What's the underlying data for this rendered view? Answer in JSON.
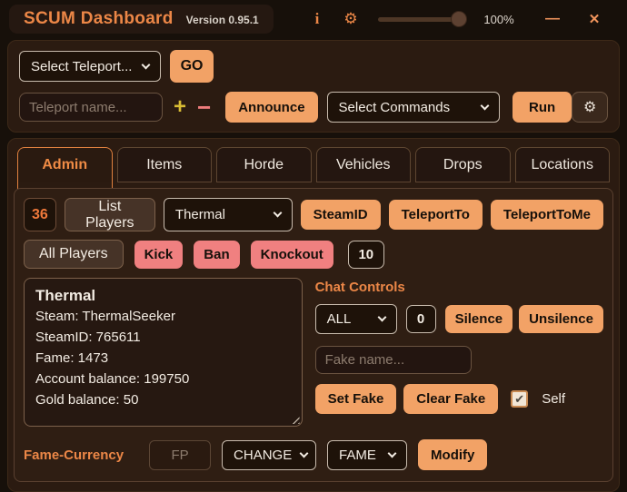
{
  "window": {
    "title": "SCUM Dashboard",
    "version": "Version 0.95.1",
    "zoom_label": "100%"
  },
  "icons": {
    "info": "i",
    "gear": "⚙",
    "minimize": "—",
    "close": "✕",
    "plus": "+",
    "minus": "−",
    "check": "✔"
  },
  "colors": {
    "accent_orange": "#f2a266",
    "danger_pink": "#f08080",
    "heading_orange": "#ec8747",
    "background": "#17100a"
  },
  "teleport_bar": {
    "select_teleport_value": "Select Teleport...",
    "go_label": "GO",
    "teleport_name_placeholder": "Teleport name...",
    "announce_label": "Announce",
    "select_commands_value": "Select Commands",
    "run_label": "Run"
  },
  "tabs": [
    {
      "label": "Admin",
      "active": true
    },
    {
      "label": "Items",
      "active": false
    },
    {
      "label": "Horde",
      "active": false
    },
    {
      "label": "Vehicles",
      "active": false
    },
    {
      "label": "Drops",
      "active": false
    },
    {
      "label": "Locations",
      "active": false
    }
  ],
  "admin": {
    "player_count": "36",
    "list_players_label": "List Players",
    "player_select_value": "Thermal",
    "steamid_label": "SteamID",
    "teleport_to_label": "TeleportTo",
    "teleport_to_me_label": "TeleportToMe",
    "all_players_label": "All Players",
    "kick_label": "Kick",
    "ban_label": "Ban",
    "knockout_label": "Knockout",
    "knockout_value": "10",
    "player_info": {
      "name": "Thermal",
      "lines": [
        "Steam: ThermalSeeker",
        "SteamID: 765611",
        "Fame: 1473",
        "Account balance: 199750",
        "Gold balance: 50"
      ]
    },
    "chat_controls": {
      "heading": "Chat Controls",
      "channel_value": "ALL",
      "duration_value": "0",
      "silence_label": "Silence",
      "unsilence_label": "Unsilence",
      "fake_name_placeholder": "Fake name...",
      "set_fake_label": "Set Fake",
      "clear_fake_label": "Clear Fake",
      "self_label": "Self",
      "self_checked": true
    },
    "fame_currency": {
      "heading": "Fame-Currency",
      "fp_placeholder": "FP",
      "action_value": "CHANGE",
      "type_value": "FAME",
      "modify_label": "Modify"
    }
  }
}
